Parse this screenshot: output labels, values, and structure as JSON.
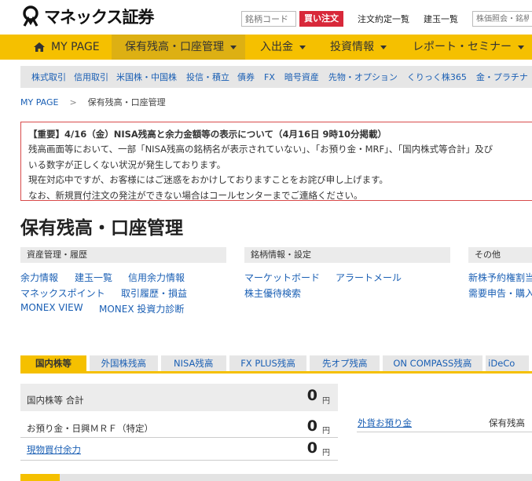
{
  "header": {
    "logo_text": "マネックス証券",
    "code_placeholder": "銘柄コード",
    "buy_button": "買い注文",
    "links": [
      "注文約定一覧",
      "建玉一覧"
    ],
    "search_placeholder": "株価照会・銘柄"
  },
  "nav": {
    "items": [
      {
        "label": "MY PAGE"
      },
      {
        "label": "保有残高・口座管理"
      },
      {
        "label": "入出金"
      },
      {
        "label": "投資情報"
      },
      {
        "label": "レポート・セミナー"
      }
    ]
  },
  "subnav": {
    "items": [
      "株式取引",
      "信用取引",
      "米国株・中国株",
      "投信・積立",
      "債券",
      "FX",
      "暗号資産",
      "先物・オプション",
      "くりっく株365",
      "金・プラチナ"
    ]
  },
  "breadcrumb": {
    "home": "MY PAGE",
    "sep": ">",
    "current": "保有残高・口座管理"
  },
  "notice": {
    "title": "【重要】4/16（金）NISA残高と余力金額等の表示について（4月16日 9時10分掲載）",
    "lines": [
      "残高画面等において、一部「NISA残高の銘柄名が表示されていない」、「お預り金・MRF」、「国内株式等合計」及び",
      "いる数字が正しくない状況が発生しております。",
      "現在対応中ですが、お客様にはご迷惑をおかけしておりますことをお詫び申し上げます。",
      "なお、新規買付注文の発注ができない場合はコールセンターまでご連絡ください。"
    ]
  },
  "page_title": "保有残高・口座管理",
  "categories": [
    {
      "header": "資産管理・履歴",
      "links": [
        "余力情報",
        "建玉一覧",
        "信用余力情報",
        "マネックスポイント",
        "取引履歴・損益",
        "MONEX VIEW",
        "MONEX 投資力診断"
      ]
    },
    {
      "header": "銘柄情報・設定",
      "links": [
        "マーケットボード",
        "アラートメール",
        "株主優待検索"
      ]
    },
    {
      "header": "その他",
      "links": [
        "新株予約権割当",
        "需要申告・購入"
      ]
    }
  ],
  "tabs": [
    "国内株等",
    "外国株残高",
    "NISA残高",
    "FX PLUS残高",
    "先オプ残高",
    "ON COMPASS残高",
    "iDeCo"
  ],
  "balances": {
    "total_label": "国内株等 合計",
    "total_value": "0",
    "unit": "円",
    "rows": [
      {
        "label": "お預り金・日興ＭＲＦ（特定）",
        "value": "0"
      },
      {
        "label": "現物買付余力",
        "value": "0"
      }
    ],
    "foreign_deposit": "外貨お預り金",
    "holdings_label": "保有残高"
  },
  "colors": {
    "accent": "#f5c000",
    "buy": "#d8283a",
    "link": "#1a5fb4",
    "notice_border": "#d84a4a"
  }
}
